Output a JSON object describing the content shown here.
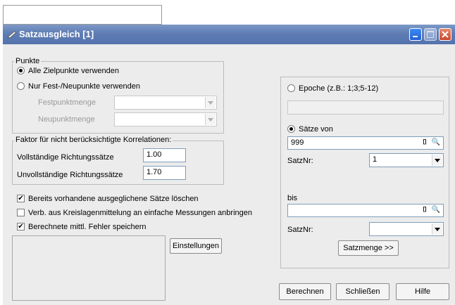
{
  "window": {
    "title": "Satzausgleich [1]"
  },
  "punkte": {
    "legend": "Punkte",
    "radio_all": "Alle Zielpunkte verwenden",
    "radio_fest": "Nur Fest-/Neupunkte verwenden",
    "festpunktmenge_label": "Festpunktmenge",
    "neupunktmenge_label": "Neupunktmenge",
    "selected": "all"
  },
  "faktor": {
    "legend": "Faktor für nicht berücksichtigte Korrelationen:",
    "vollst_label": "Vollständige Richtungssätze",
    "vollst_value": "1.00",
    "unvollst_label": "Unvollständige Richtungssätze",
    "unvollst_value": "1.70"
  },
  "options": {
    "opt1": "Bereits vorhandene ausgeglichene Sätze löschen",
    "opt2": "Verb. aus Kreislagenmittelung an einfache Messungen anbringen",
    "opt3": "Berechnete mittl. Fehler speichern",
    "checked": [
      true,
      false,
      true
    ],
    "check_glyph": "✔"
  },
  "einstellungen_label": "Einstellungen",
  "right": {
    "epoche_label": "Epoche (z.B.: 1;3;5-12)",
    "epoche_value": "",
    "saetze_label": "Sätze von",
    "von_value": "999",
    "satznr_label": "SatzNr:",
    "satznr_value": "1",
    "bis_label": "bis",
    "bis_value": "",
    "satznr2_label": "SatzNr:",
    "satznr2_value": "",
    "satzmenge_label": "Satzmenge >>"
  },
  "buttons": {
    "berechnen": "Berechnen",
    "schliessen": "Schließen",
    "hilfe": "Hilfe"
  }
}
